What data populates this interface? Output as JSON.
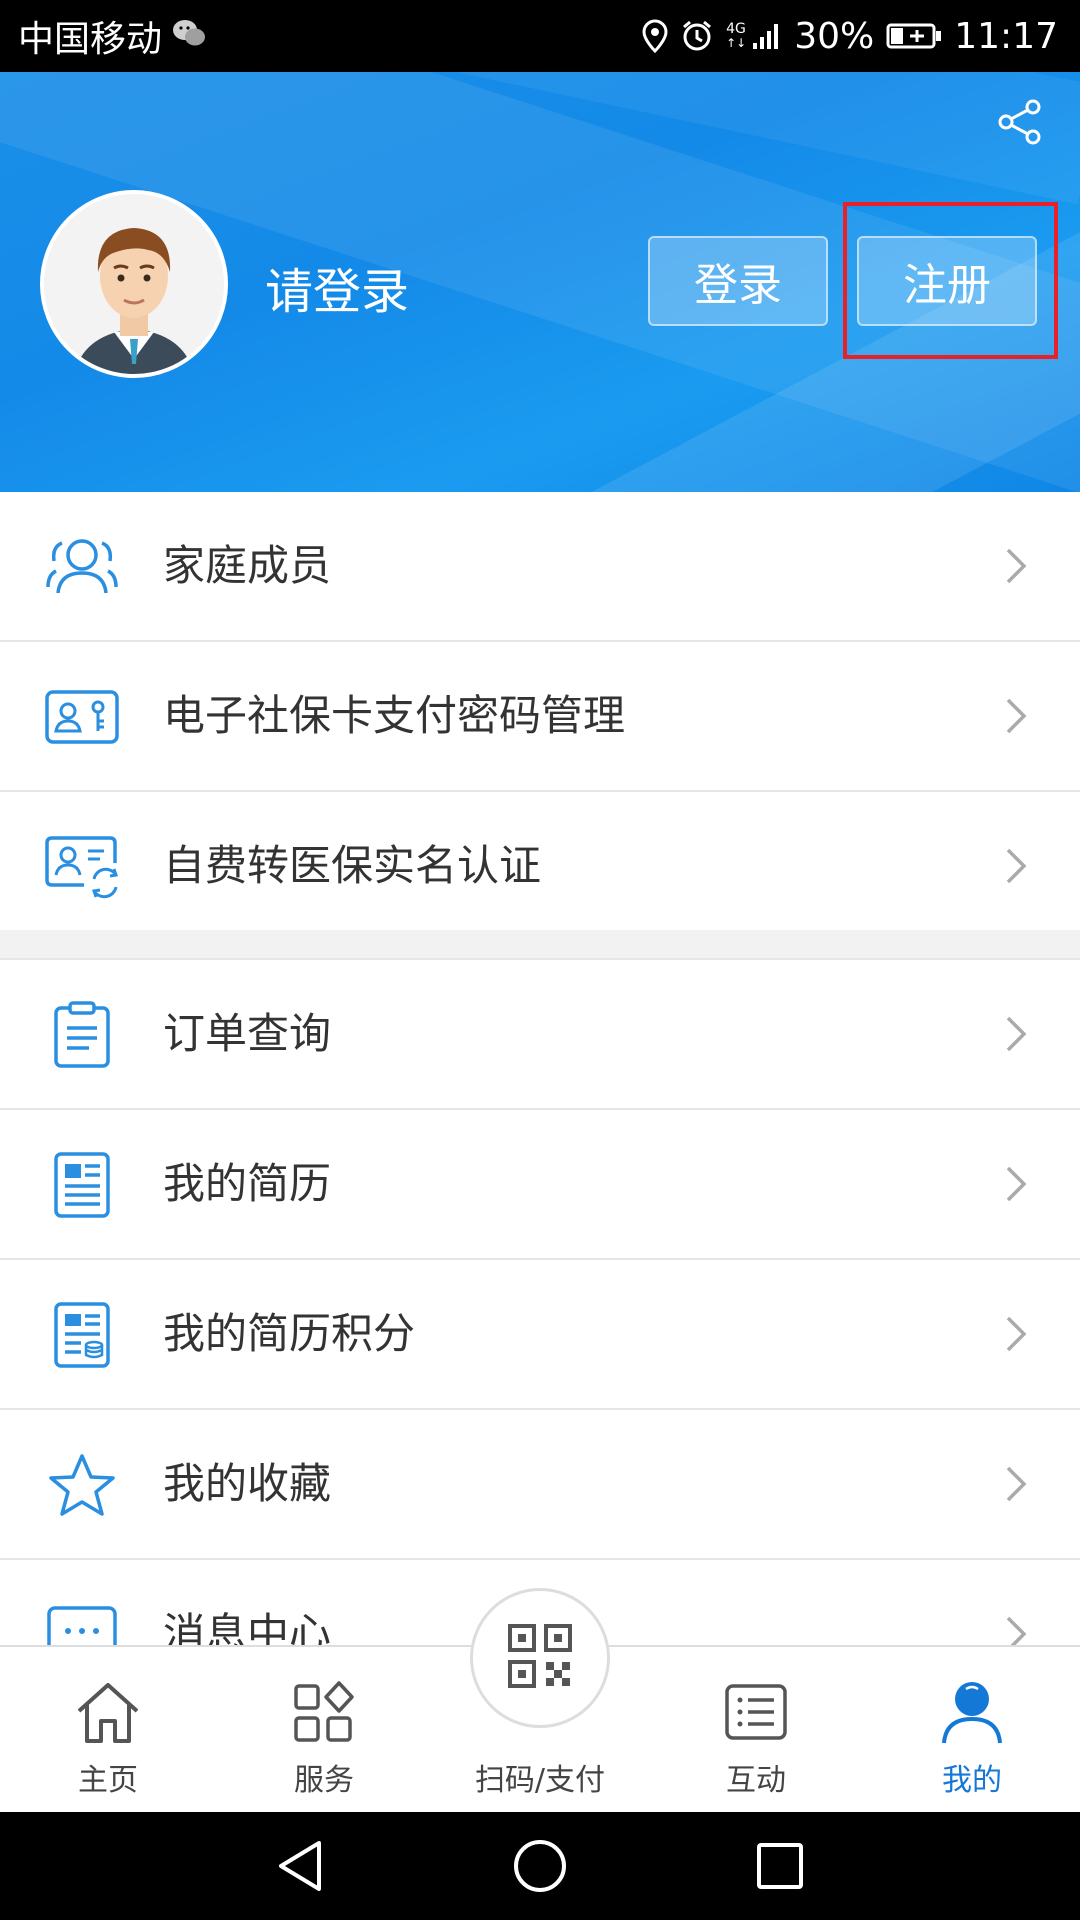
{
  "status_bar": {
    "carrier": "中国移动",
    "network": "4G",
    "battery": "30%",
    "time": "11:17"
  },
  "profile": {
    "login_prompt": "请登录",
    "login_button": "登录",
    "register_button": "注册"
  },
  "menu_group_1": [
    {
      "label": "家庭成员",
      "icon": "family-members-icon"
    },
    {
      "label": "电子社保卡支付密码管理",
      "icon": "social-card-icon"
    },
    {
      "label": "自费转医保实名认证",
      "icon": "id-verify-icon"
    }
  ],
  "menu_group_2": [
    {
      "label": "订单查询",
      "icon": "clipboard-icon"
    },
    {
      "label": "我的简历",
      "icon": "resume-icon"
    },
    {
      "label": "我的简历积分",
      "icon": "resume-points-icon"
    },
    {
      "label": "我的收藏",
      "icon": "star-icon"
    },
    {
      "label": "消息中心",
      "icon": "message-icon"
    }
  ],
  "tabbar": {
    "home": "主页",
    "service": "服务",
    "scan_pay": "扫码/支付",
    "interact": "互动",
    "mine": "我的"
  },
  "colors": {
    "header_blue": "#148ae8",
    "accent": "#1478d7",
    "highlight_red": "#e8202a"
  }
}
